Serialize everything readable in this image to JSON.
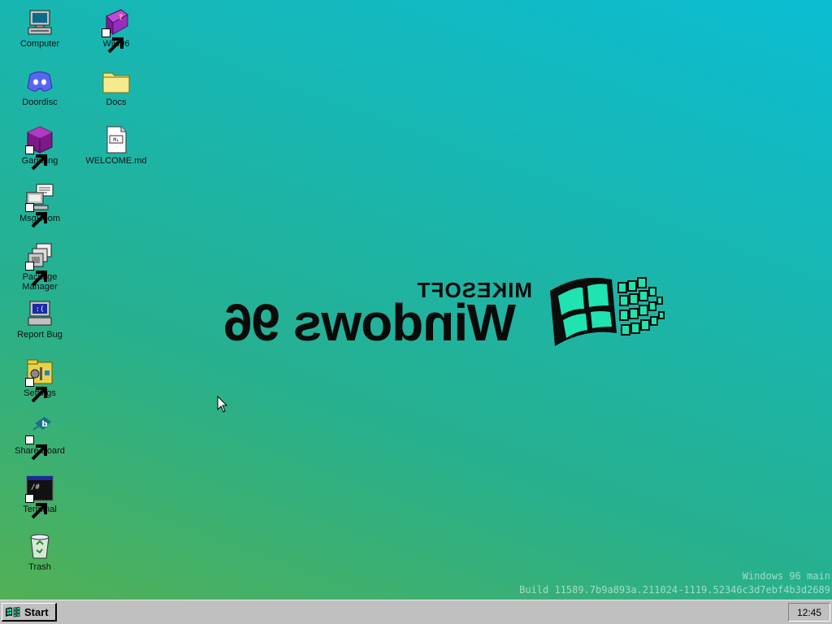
{
  "desktop": {
    "icons": [
      {
        "label": "Computer",
        "icon": "computer-icon"
      },
      {
        "label": "Wiki96",
        "icon": "help-book-icon"
      },
      {
        "label": "Doordisc",
        "icon": "discord-icon"
      },
      {
        "label": "Docs",
        "icon": "folder-icon"
      },
      {
        "label": "Gameing",
        "icon": "purple-cube-icon"
      },
      {
        "label": "WELCOME.md",
        "icon": "markdown-file-icon"
      },
      {
        "label": "MsgRoom",
        "icon": "msgroom-icon"
      },
      {
        "label": "Package Manager",
        "icon": "package-manager-icon"
      },
      {
        "label": "Report Bug",
        "icon": "report-bug-icon"
      },
      {
        "label": "Settings",
        "icon": "settings-icon"
      },
      {
        "label": "Share Board",
        "icon": "share-board-icon"
      },
      {
        "label": "Terminal",
        "icon": "terminal-icon"
      },
      {
        "label": "Trash",
        "icon": "recycle-bin-icon"
      }
    ]
  },
  "logo": {
    "brand": "MIKESOFT",
    "product": "Windows 96"
  },
  "build_info": {
    "line1": "Windows 96 main",
    "line2": "Build 11589.7b9a893a.211024-1119.52346c3d7ebf4b3d2689"
  },
  "taskbar": {
    "start_label": "Start",
    "clock": "12:45"
  },
  "colors": {
    "desktop_top": "#0bbdd2",
    "desktop_bottom": "#52b054",
    "taskbar": "#c0c0c0",
    "logo_flag": "#1fe3b0"
  }
}
